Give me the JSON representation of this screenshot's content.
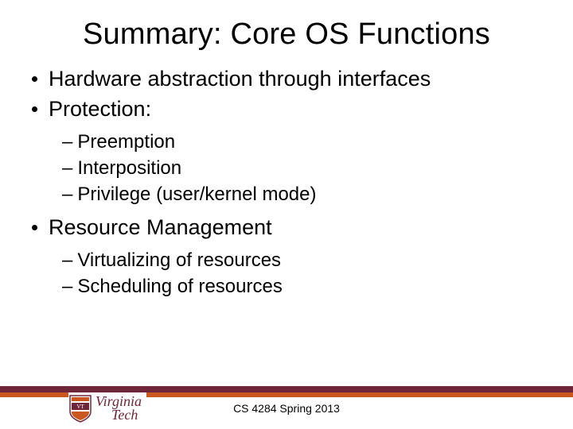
{
  "title": "Summary: Core OS Functions",
  "bullets": {
    "b1": "Hardware abstraction through interfaces",
    "b2": "Protection:",
    "b2_sub": {
      "s1": "Preemption",
      "s2": "Interposition",
      "s3": "Privilege (user/kernel mode)"
    },
    "b3": "Resource Management",
    "b3_sub": {
      "s1": "Virtualizing of resources",
      "s2": "Scheduling of resources"
    }
  },
  "footer": "CS 4284 Spring 2013",
  "logo": {
    "line1": "Virginia",
    "line2": "Tech"
  }
}
